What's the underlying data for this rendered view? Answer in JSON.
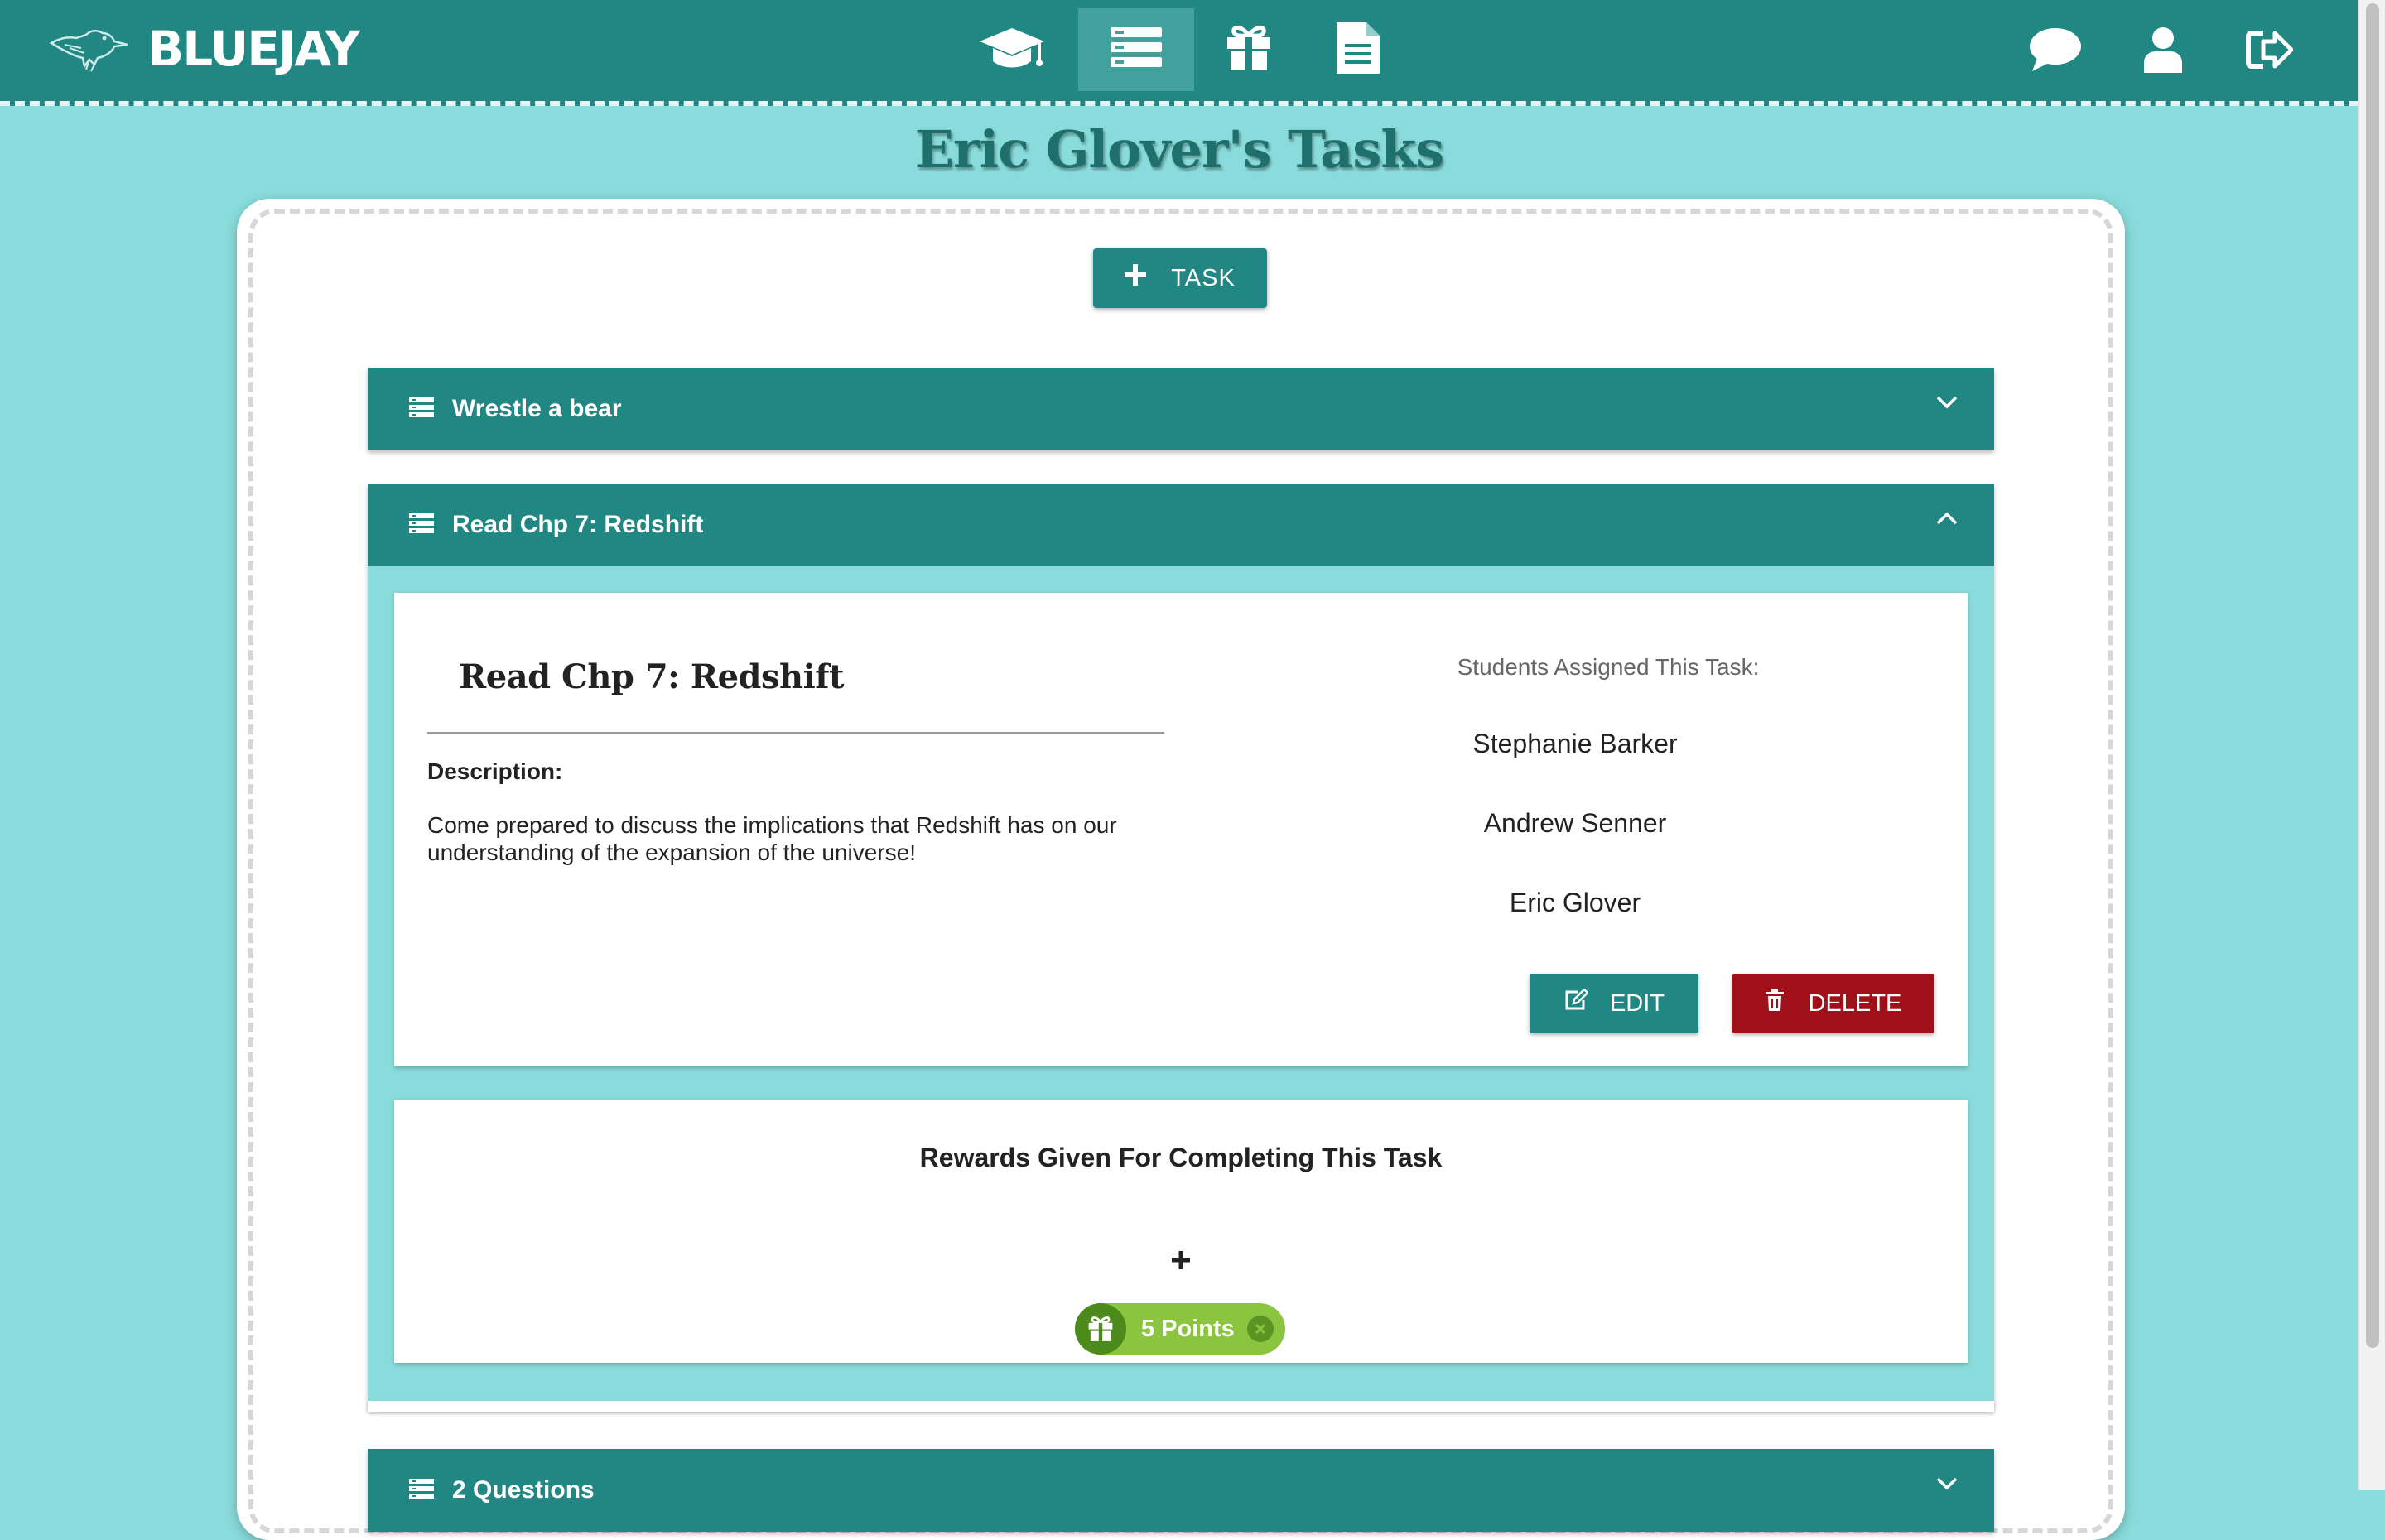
{
  "app": {
    "brand_name": "BLUEJAY"
  },
  "nav": {
    "items": [
      {
        "icon": "graduation-cap-icon",
        "active": false
      },
      {
        "icon": "tasks-list-icon",
        "active": true
      },
      {
        "icon": "gift-icon",
        "active": false
      },
      {
        "icon": "document-icon",
        "active": false
      }
    ],
    "right_items": [
      {
        "icon": "chat-bubble-icon"
      },
      {
        "icon": "user-icon"
      },
      {
        "icon": "sign-out-icon"
      }
    ]
  },
  "page": {
    "title": "Eric Glover's Tasks",
    "add_task_label": "TASK"
  },
  "tasks": [
    {
      "title": "Wrestle a bear",
      "expanded": false
    },
    {
      "title": "Read Chp 7: Redshift",
      "expanded": true
    },
    {
      "title": "2 Questions",
      "expanded": false
    }
  ],
  "task_detail": {
    "name": "Read Chp 7: Redshift",
    "description_label": "Description:",
    "description": "Come prepared to discuss the implications that Redshift has on our understanding of the expansion of the universe!",
    "assigned_label": "Students Assigned This Task:",
    "students": [
      "Stephanie Barker",
      "Andrew Senner",
      "Eric Glover"
    ],
    "edit_label": "EDIT",
    "delete_label": "DELETE"
  },
  "rewards": {
    "title": "Rewards Given For Completing This Task",
    "add_symbol": "+",
    "items": [
      {
        "label": "5 Points"
      }
    ]
  },
  "colors": {
    "primary": "#218783",
    "background": "#8adcdc",
    "danger": "#a01019",
    "reward": "#8bc53f",
    "title": "#1f6f6c"
  }
}
